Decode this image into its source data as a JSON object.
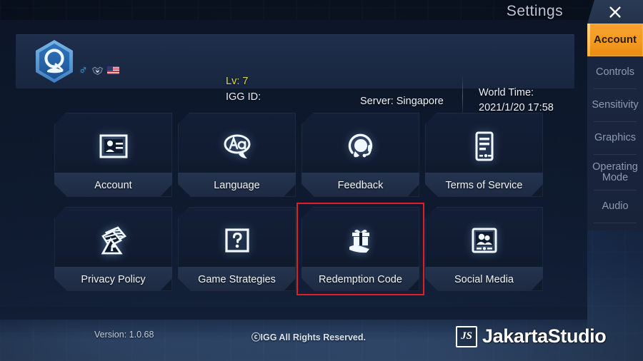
{
  "window": {
    "title": "Settings",
    "close_icon": "close-x-icon"
  },
  "accent_colors": {
    "active_tab": "#f59a22",
    "highlight_border": "#e02020",
    "level_text": "#d6dc45",
    "panel_bg": "#101b30",
    "tile_label_bg": "#25344f"
  },
  "player": {
    "avatar_icon": "hexagon-avatar-icon",
    "badges": [
      {
        "name": "gender-male-badge",
        "glyph": "♂"
      },
      {
        "name": "guild-emblem-badge"
      },
      {
        "name": "country-flag-badge-us"
      }
    ],
    "level_label": "Lv: 7",
    "igg_id_label": "IGG ID:",
    "server_label": "Server: Singapore",
    "world_time_label": "World Time:",
    "world_time_value": "2021/1/20 17:58"
  },
  "sidebar": {
    "tabs": [
      {
        "label": "Account",
        "active": true
      },
      {
        "label": "Controls",
        "active": false
      },
      {
        "label": "Sensitivity",
        "active": false
      },
      {
        "label": "Graphics",
        "active": false
      },
      {
        "label": "Operating Mode",
        "active": false
      },
      {
        "label": "Audio",
        "active": false
      }
    ]
  },
  "main": {
    "tiles": [
      {
        "label": "Account",
        "icon": "id-card-icon",
        "highlighted": false
      },
      {
        "label": "Language",
        "icon": "speech-bubble-aa-icon",
        "highlighted": false
      },
      {
        "label": "Feedback",
        "icon": "headset-icon",
        "highlighted": false
      },
      {
        "label": "Terms of Service",
        "icon": "document-tablet-icon",
        "highlighted": false
      },
      {
        "label": "Privacy Policy",
        "icon": "privacy-documents-icon",
        "highlighted": false
      },
      {
        "label": "Game Strategies",
        "icon": "question-mark-box-icon",
        "highlighted": false
      },
      {
        "label": "Redemption Code",
        "icon": "gift-on-hand-icon",
        "highlighted": true
      },
      {
        "label": "Social Media",
        "icon": "people-frame-icon",
        "highlighted": false
      }
    ]
  },
  "footer": {
    "version": "Version: 1.0.68",
    "copyright": "ⓒIGG All Rights Reserved."
  },
  "watermark": {
    "mark": "JS",
    "text": "JakartaStudio"
  }
}
